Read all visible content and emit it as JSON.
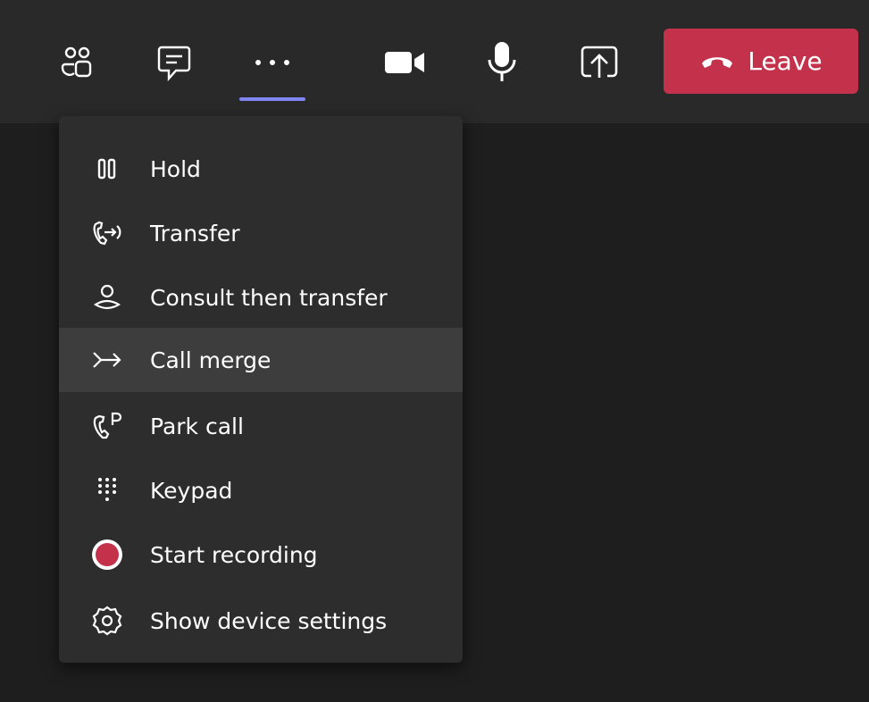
{
  "toolbar": {
    "leave_label": "Leave",
    "accent_color": "#7f85f5",
    "leave_color": "#c4314b",
    "icons": [
      "people-icon",
      "chat-icon",
      "more-options-icon",
      "camera-icon",
      "microphone-icon",
      "share-screen-icon",
      "hang-up-icon"
    ]
  },
  "menu": {
    "items": [
      {
        "label": "Hold",
        "icon": "pause-icon"
      },
      {
        "label": "Transfer",
        "icon": "transfer-icon"
      },
      {
        "label": "Consult then transfer",
        "icon": "consult-transfer-icon"
      },
      {
        "label": "Call merge",
        "icon": "merge-icon"
      },
      {
        "label": "Park call",
        "icon": "park-call-icon"
      },
      {
        "label": "Keypad",
        "icon": "keypad-icon"
      },
      {
        "label": "Start recording",
        "icon": "record-icon"
      },
      {
        "label": "Show device settings",
        "icon": "gear-icon"
      }
    ],
    "highlighted_item": "Call merge",
    "record_color": "#c4314b"
  }
}
